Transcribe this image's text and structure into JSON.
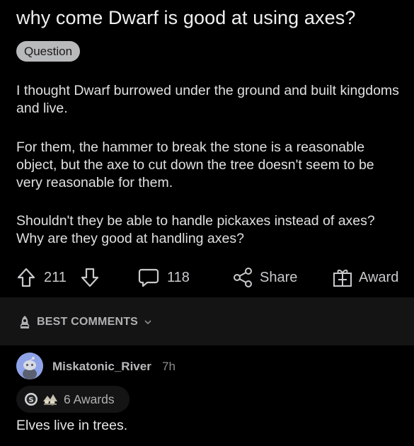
{
  "post": {
    "title": "why come Dwarf is good at using axes?",
    "flair": "Question",
    "paragraphs": [
      "I thought Dwarf burrowed under the ground and built kingdoms and live.",
      "For them, the hammer to break the stone is a reasonable object, but the axe to cut down the tree doesn't seem to be very reasonable for them.",
      "Shouldn't they be able to handle pickaxes instead of axes? Why are they good at handling axes?"
    ]
  },
  "actions": {
    "upvote_icon": "arrow-up-icon",
    "vote_count": "211",
    "downvote_icon": "arrow-down-icon",
    "comment_icon": "speech-bubble-icon",
    "comment_count": "118",
    "share_icon": "share-icon",
    "share_label": "Share",
    "award_icon": "gift-icon",
    "award_label": "Award"
  },
  "sort": {
    "icon": "rocket-icon",
    "label": "BEST COMMENTS"
  },
  "comment": {
    "author": "Miskatonic_River",
    "time": "7h",
    "awards_label": "6 Awards",
    "body": "Elves live in trees."
  },
  "colors": {
    "background": "#000000",
    "bar": "#141414",
    "flair_bg": "#b8b9bb",
    "avatar_bg": "#8fa3e8"
  }
}
